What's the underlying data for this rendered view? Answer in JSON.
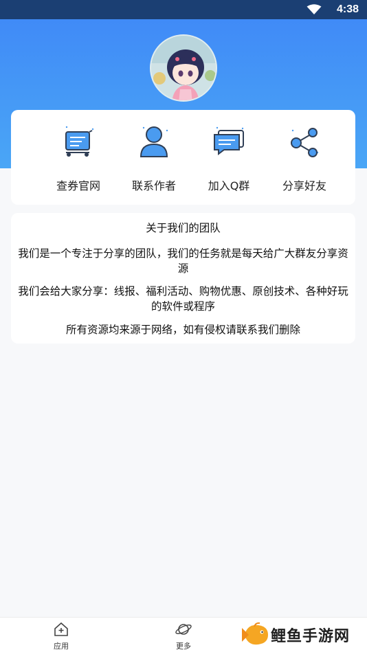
{
  "status_bar": {
    "time": "4:38"
  },
  "actions": [
    {
      "label": "查券官网",
      "icon": "shopping-cart-icon"
    },
    {
      "label": "联系作者",
      "icon": "user-icon"
    },
    {
      "label": "加入Q群",
      "icon": "chat-icon"
    },
    {
      "label": "分享好友",
      "icon": "share-icon"
    }
  ],
  "about": {
    "title": "关于我们的团队",
    "paragraph1": "我们是一个专注于分享的团队，我们的任务就是每天给广大群友分享资源",
    "paragraph2": "我们会给大家分享：线报、福利活动、购物优惠、原创技术、各种好玩的软件或程序",
    "paragraph3": "所有资源均来源于网络，如有侵权请联系我们删除"
  },
  "bottom_nav": [
    {
      "label": "应用",
      "icon": "home-icon"
    },
    {
      "label": "更多",
      "icon": "planet-icon"
    }
  ],
  "watermark": {
    "text": "鲤鱼手游网"
  },
  "colors": {
    "accent": "#3f87f7",
    "icon_blue": "#4a9bf0"
  }
}
